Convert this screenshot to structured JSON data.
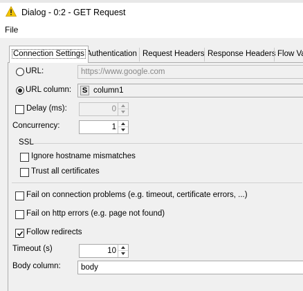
{
  "window": {
    "title": "Dialog - 0:2 - GET Request"
  },
  "menu": {
    "file_label": "File"
  },
  "tabs": [
    {
      "label": "Connection Settings",
      "active": true
    },
    {
      "label": "Authentication"
    },
    {
      "label": "Request Headers"
    },
    {
      "label": "Response Headers"
    },
    {
      "label": "Flow Va"
    }
  ],
  "connection": {
    "url_label": "URL:",
    "url_placeholder": "https://www.google.com",
    "url_selected": false,
    "url_column_label": "URL column:",
    "url_column_selected": true,
    "url_column_type": "S",
    "url_column_value": "column1",
    "delay_label": "Delay (ms):",
    "delay_checked": false,
    "delay_value": "0",
    "concurrency_label": "Concurrency:",
    "concurrency_value": "1",
    "ssl_label": "SSL",
    "ignore_hostname_label": "Ignore hostname mismatches",
    "ignore_hostname_checked": false,
    "trust_all_label": "Trust all certificates",
    "trust_all_checked": false,
    "fail_connection_label": "Fail on connection problems (e.g. timeout, certificate errors, ...)",
    "fail_connection_checked": false,
    "fail_http_label": "Fail on http errors (e.g. page not found)",
    "fail_http_checked": false,
    "follow_redirects_label": "Follow redirects",
    "follow_redirects_checked": true,
    "timeout_label": "Timeout (s)",
    "timeout_value": "10",
    "body_column_label": "Body column:",
    "body_column_value": "body"
  },
  "colors": {
    "panel": "#f0f0f0",
    "warning_icon": "#f2c500",
    "border": "#adadad"
  },
  "icons": {
    "window": "warning-icon",
    "column_type": "string-type-icon"
  }
}
